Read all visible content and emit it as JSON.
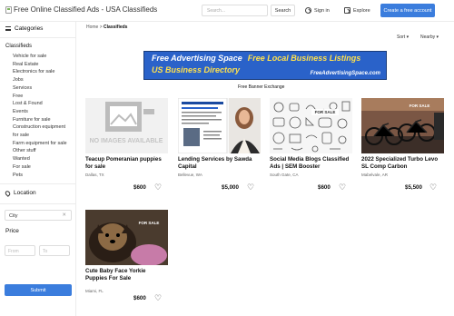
{
  "header": {
    "logo_alt": "Free Online Classified Ads - USA Classifieds",
    "search_placeholder": "Search...",
    "search_button": "Search",
    "signin": "Sign in",
    "explore": "Explore",
    "create": "Create a free account"
  },
  "sidebar": {
    "categories_head": "Categories",
    "classifieds_title": "Classifieds",
    "items": [
      "Vehicle for sale",
      "Real Estate",
      "Electronics for sale",
      "Jobs",
      "Services",
      "Free",
      "Lost & Found",
      "Events",
      "Furniture for sale",
      "Construction equipment",
      "for sale",
      "Farm equipment for sale",
      "Other stuff",
      "Wanted",
      "For sale",
      "Pets"
    ],
    "location_head": "Location",
    "city_value": "City",
    "price_head": "Price",
    "price_from_placeholder": "From",
    "price_to_placeholder": "To",
    "submit": "Submit"
  },
  "main": {
    "breadcrumb_home": "Home",
    "breadcrumb_sep": " > ",
    "breadcrumb_current": "Classifieds",
    "sort": "Sort",
    "nearby": "Nearby",
    "banner": {
      "line1a": "Free Advertising Space",
      "line1b": "Free Local Business Listings",
      "line2": "US Business Directory",
      "url": "FreeAdvertisingSpace.com"
    },
    "banner_caption": "Free Banner Exchange",
    "no_image_text": "NO IMAGES AVAILABLE",
    "forsale_tag": "FOR SALE"
  },
  "listings": [
    {
      "title": "Teacup Pomeranian puppies for sale",
      "location": "Dallas, TX",
      "price": "$600"
    },
    {
      "title": "Lending Services by Sawda Capital",
      "location": "Bellevue, WA",
      "price": "$5,000"
    },
    {
      "title": "Social Media Blogs Classified Ads | SEM Booster",
      "location": "South Gate, CA",
      "price": "$600"
    },
    {
      "title": "2022 Specialized Turbo Levo SL Comp Carbon",
      "location": "Mabelvale, AR",
      "price": "$5,500"
    },
    {
      "title": "Cute Baby Face Yorkie Puppies For Sale",
      "location": "Miami, FL",
      "price": "$600"
    }
  ],
  "colors": {
    "accent": "#3b7ddd",
    "banner_blue": "#2a62c9",
    "banner_yellow": "#ffe14d"
  },
  "icons": [
    "broken-image-icon",
    "hamburger-icon",
    "signin-icon",
    "explore-icon",
    "location-pin-icon",
    "heart-icon",
    "chevron-down-icon"
  ]
}
